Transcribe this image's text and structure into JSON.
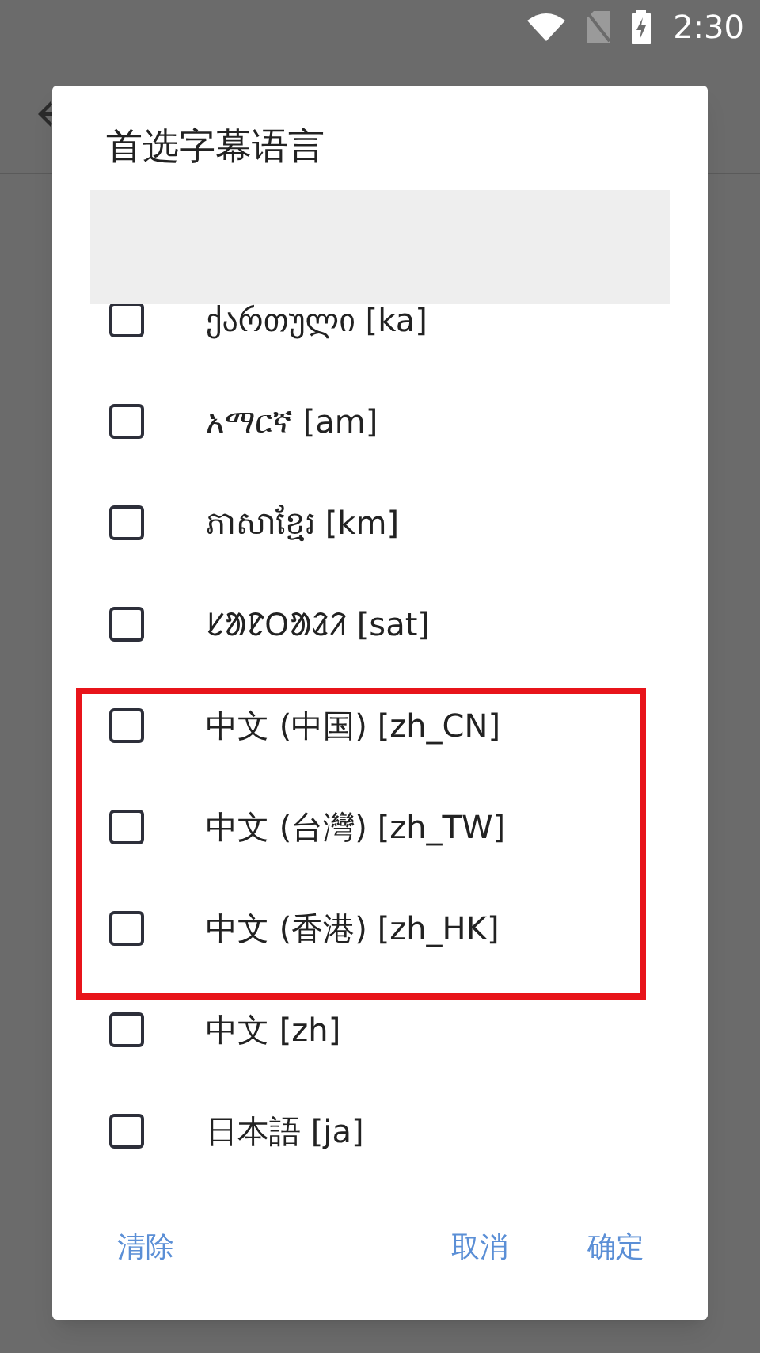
{
  "status_bar": {
    "time": "2:30"
  },
  "dialog": {
    "title": "首选字幕语言",
    "languages": [
      {
        "label": "ქართული [ka]",
        "checked": false
      },
      {
        "label": "አማርኛ [am]",
        "checked": false
      },
      {
        "label": "ភាសាខ្មែរ [km]",
        "checked": false
      },
      {
        "label": "ᱥᱟᱱᱛᱟᱲᱤ [sat]",
        "checked": false
      },
      {
        "label": "中文 (中国) [zh_CN]",
        "checked": false
      },
      {
        "label": "中文 (台灣) [zh_TW]",
        "checked": false
      },
      {
        "label": "中文 (香港) [zh_HK]",
        "checked": false
      },
      {
        "label": "中文 [zh]",
        "checked": false
      },
      {
        "label": "日本語 [ja]",
        "checked": false
      }
    ],
    "buttons": [
      {
        "label": "清除",
        "kind": "left"
      },
      {
        "label": "取消",
        "kind": "right"
      },
      {
        "label": "确定",
        "kind": "right"
      }
    ]
  }
}
